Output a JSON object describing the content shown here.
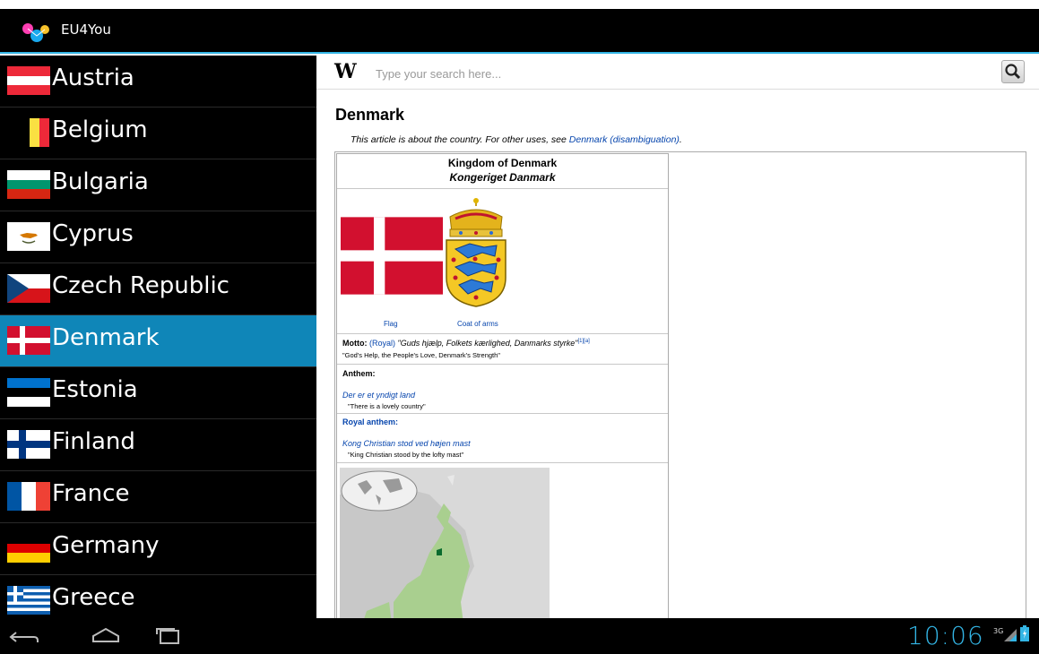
{
  "app": {
    "title": "EU4You"
  },
  "countries": [
    {
      "name": "Austria",
      "flag": "austria-flag-icon",
      "active": false
    },
    {
      "name": "Belgium",
      "flag": "belgium-flag-icon",
      "active": false
    },
    {
      "name": "Bulgaria",
      "flag": "bulgaria-flag-icon",
      "active": false
    },
    {
      "name": "Cyprus",
      "flag": "cyprus-flag-icon",
      "active": false
    },
    {
      "name": "Czech Republic",
      "flag": "czech-flag-icon",
      "active": false
    },
    {
      "name": "Denmark",
      "flag": "denmark-flag-icon",
      "active": true
    },
    {
      "name": "Estonia",
      "flag": "estonia-flag-icon",
      "active": false
    },
    {
      "name": "Finland",
      "flag": "finland-flag-icon",
      "active": false
    },
    {
      "name": "France",
      "flag": "france-flag-icon",
      "active": false
    },
    {
      "name": "Germany",
      "flag": "germany-flag-icon",
      "active": false
    },
    {
      "name": "Greece",
      "flag": "greece-flag-icon",
      "active": false
    }
  ],
  "search": {
    "placeholder": "Type your search here...",
    "logo": "W"
  },
  "article": {
    "title": "Denmark",
    "hatnote_prefix": "This article is about the country. For other uses, see ",
    "hatnote_link": "Denmark (disambiguation)",
    "hatnote_suffix": ".",
    "infobox": {
      "name": "Kingdom of Denmark",
      "native_name": "Kongeriget Danmark",
      "flag_caption": "Flag",
      "coat_caption": "Coat of arms",
      "motto_label": "Motto:",
      "motto_link": "(Royal)",
      "motto_text": "\"Guds hjælp, Folkets kærlighed, Danmarks styrke\"",
      "motto_refs": "[1][a]",
      "motto_translation": "\"God's Help, the People's Love, Denmark's Strength\"",
      "anthem_label": "Anthem:",
      "anthem_title": "Der er et yndigt land",
      "anthem_translation": "\"There is a lovely country\"",
      "royal_anthem_label": "Royal anthem:",
      "royal_anthem_title": "Kong Christian stod ved højen mast",
      "royal_anthem_translation": "\"King Christian stood by the lofty mast\""
    }
  },
  "status": {
    "clock": "10:06",
    "network": "3G"
  },
  "colors": {
    "accent": "#33b5e5",
    "selected_row": "#0f86b8",
    "danish_red": "#d2102f",
    "link": "#0645ad"
  },
  "nav_icons": [
    "back-icon",
    "home-icon",
    "recent-apps-icon"
  ]
}
